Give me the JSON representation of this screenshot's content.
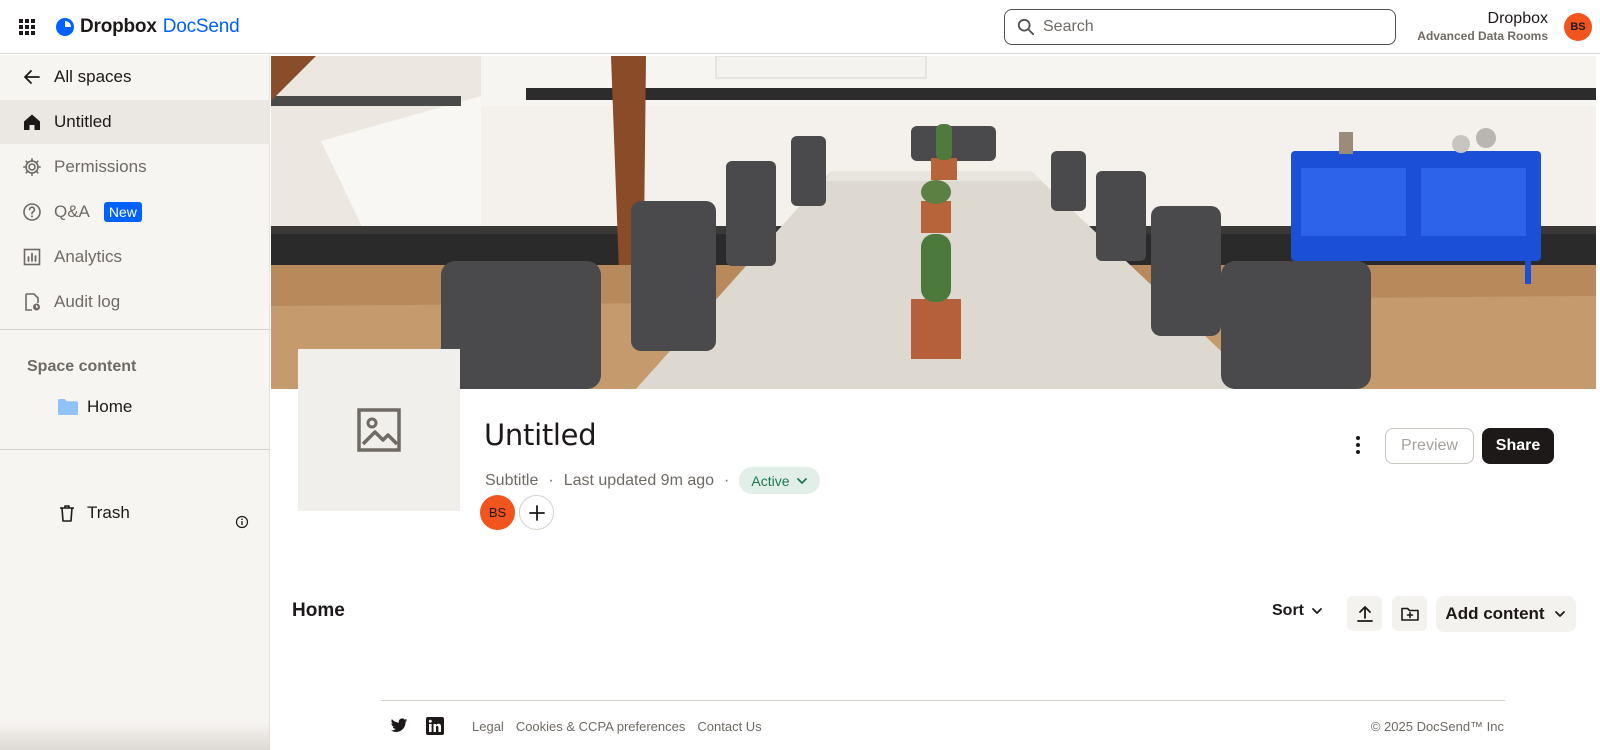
{
  "app": {
    "brand_primary": "Dropbox",
    "brand_secondary": "DocSend",
    "accent": "#0061fe",
    "avatar_color": "#f1541c"
  },
  "header": {
    "search_placeholder": "Search",
    "org_name": "Dropbox",
    "plan_name": "Advanced Data Rooms",
    "user_initials": "BS"
  },
  "sidebar": {
    "back_label": "All spaces",
    "items": [
      {
        "label": "Untitled",
        "icon": "home-icon",
        "active": true
      },
      {
        "label": "Permissions",
        "icon": "gear-icon"
      },
      {
        "label": "Q&A",
        "icon": "question-icon",
        "badge": "New"
      },
      {
        "label": "Analytics",
        "icon": "bar-chart-icon"
      },
      {
        "label": "Audit log",
        "icon": "audit-icon"
      }
    ],
    "section_label": "Space content",
    "folder_label": "Home",
    "trash_label": "Trash"
  },
  "space": {
    "title": "Untitled",
    "subtitle": "Subtitle",
    "separator": "·",
    "last_updated": "Last updated 9m ago",
    "status": "Active",
    "member_initials": "BS",
    "preview_label": "Preview",
    "share_label": "Share"
  },
  "content": {
    "heading": "Home",
    "sort_label": "Sort",
    "add_content_label": "Add content"
  },
  "footer": {
    "links": [
      "Legal",
      "Cookies & CCPA preferences",
      "Contact Us"
    ],
    "copyright": "© 2025 DocSend™ Inc"
  }
}
